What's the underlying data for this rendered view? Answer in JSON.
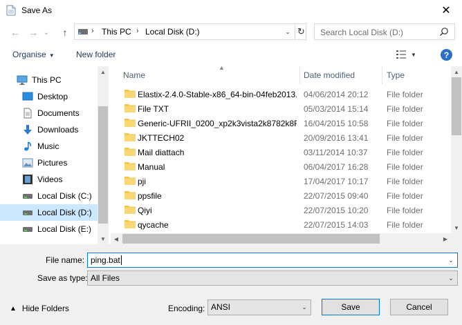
{
  "window": {
    "title": "Save As",
    "close_glyph": "✕"
  },
  "nav": {
    "back_glyph": "←",
    "forward_glyph": "→",
    "recent_glyph": "⌄",
    "up_glyph": "↑",
    "crumbs": [
      "This PC",
      "Local Disk (D:)"
    ],
    "crumb_sep": "›",
    "dropdown_glyph": "⌄",
    "refresh_glyph": "↻",
    "search_placeholder": "Search Local Disk (D:)"
  },
  "toolbar": {
    "organise_label": "Organise",
    "new_folder_label": "New folder",
    "caret": "▼",
    "help_label": "?"
  },
  "sidebar": {
    "items": [
      {
        "label": "This PC",
        "icon": "computer-icon",
        "selected": false
      },
      {
        "label": "Desktop",
        "icon": "desktop-icon",
        "selected": false
      },
      {
        "label": "Documents",
        "icon": "documents-icon",
        "selected": false
      },
      {
        "label": "Downloads",
        "icon": "downloads-icon",
        "selected": false
      },
      {
        "label": "Music",
        "icon": "music-icon",
        "selected": false
      },
      {
        "label": "Pictures",
        "icon": "pictures-icon",
        "selected": false
      },
      {
        "label": "Videos",
        "icon": "videos-icon",
        "selected": false
      },
      {
        "label": "Local Disk (C:)",
        "icon": "drive-icon",
        "selected": false
      },
      {
        "label": "Local Disk (D:)",
        "icon": "drive-icon",
        "selected": true
      },
      {
        "label": "Local Disk (E:)",
        "icon": "drive-icon",
        "selected": false
      }
    ]
  },
  "files": {
    "columns": {
      "name": "Name",
      "date": "Date modified",
      "type": "Type"
    },
    "rows": [
      {
        "name": "Elastix-2.4.0-Stable-x86_64-bin-04feb2013...",
        "date": "04/06/2014 20:12",
        "type": "File folder"
      },
      {
        "name": "File TXT",
        "date": "05/03/2014 15:14",
        "type": "File folder"
      },
      {
        "name": "Generic-UFRII_0200_xp2k3vista2k8782k8R...",
        "date": "16/04/2015 10:58",
        "type": "File folder"
      },
      {
        "name": "JKTTECH02",
        "date": "20/09/2016 13:41",
        "type": "File folder"
      },
      {
        "name": "Mail diattach",
        "date": "03/11/2014 10:37",
        "type": "File folder"
      },
      {
        "name": "Manual",
        "date": "06/04/2017 16:28",
        "type": "File folder"
      },
      {
        "name": "pji",
        "date": "17/04/2017 10:17",
        "type": "File folder"
      },
      {
        "name": "ppsfile",
        "date": "22/07/2015 09:40",
        "type": "File folder"
      },
      {
        "name": "Qiyi",
        "date": "22/07/2015 10:20",
        "type": "File folder"
      },
      {
        "name": "qycache",
        "date": "22/07/2015 14:03",
        "type": "File folder"
      }
    ]
  },
  "form": {
    "file_name_label": "File name:",
    "file_name_value": "ping.bat",
    "save_as_type_label": "Save as type:",
    "save_as_type_value": "All Files",
    "hide_folders_label": "Hide Folders",
    "encoding_label": "Encoding:",
    "encoding_value": "ANSI",
    "save_label": "Save",
    "cancel_label": "Cancel"
  },
  "colors": {
    "accent": "#0078d7",
    "selected_bg": "#cce8ff",
    "folder_yellow": "#f5c343",
    "help_blue": "#2a6fc9"
  }
}
